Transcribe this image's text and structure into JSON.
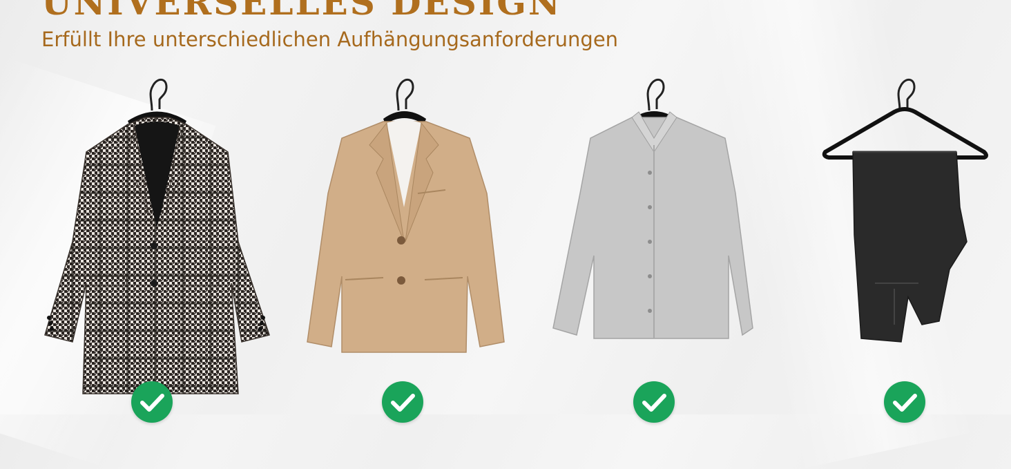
{
  "heading": {
    "title": "UNIVERSELLES DESIGN",
    "subtitle": "Erfüllt Ihre unterschiedlichen Aufhängungsanforderungen"
  },
  "colors": {
    "heading": "#b06f1e",
    "check": "#1aa45a"
  },
  "items": [
    {
      "garment": "houndstooth-coat",
      "icon": "check-icon"
    },
    {
      "garment": "beige-blazer",
      "icon": "check-icon"
    },
    {
      "garment": "grey-shirt",
      "icon": "check-icon"
    },
    {
      "garment": "black-trousers",
      "icon": "check-icon"
    }
  ]
}
